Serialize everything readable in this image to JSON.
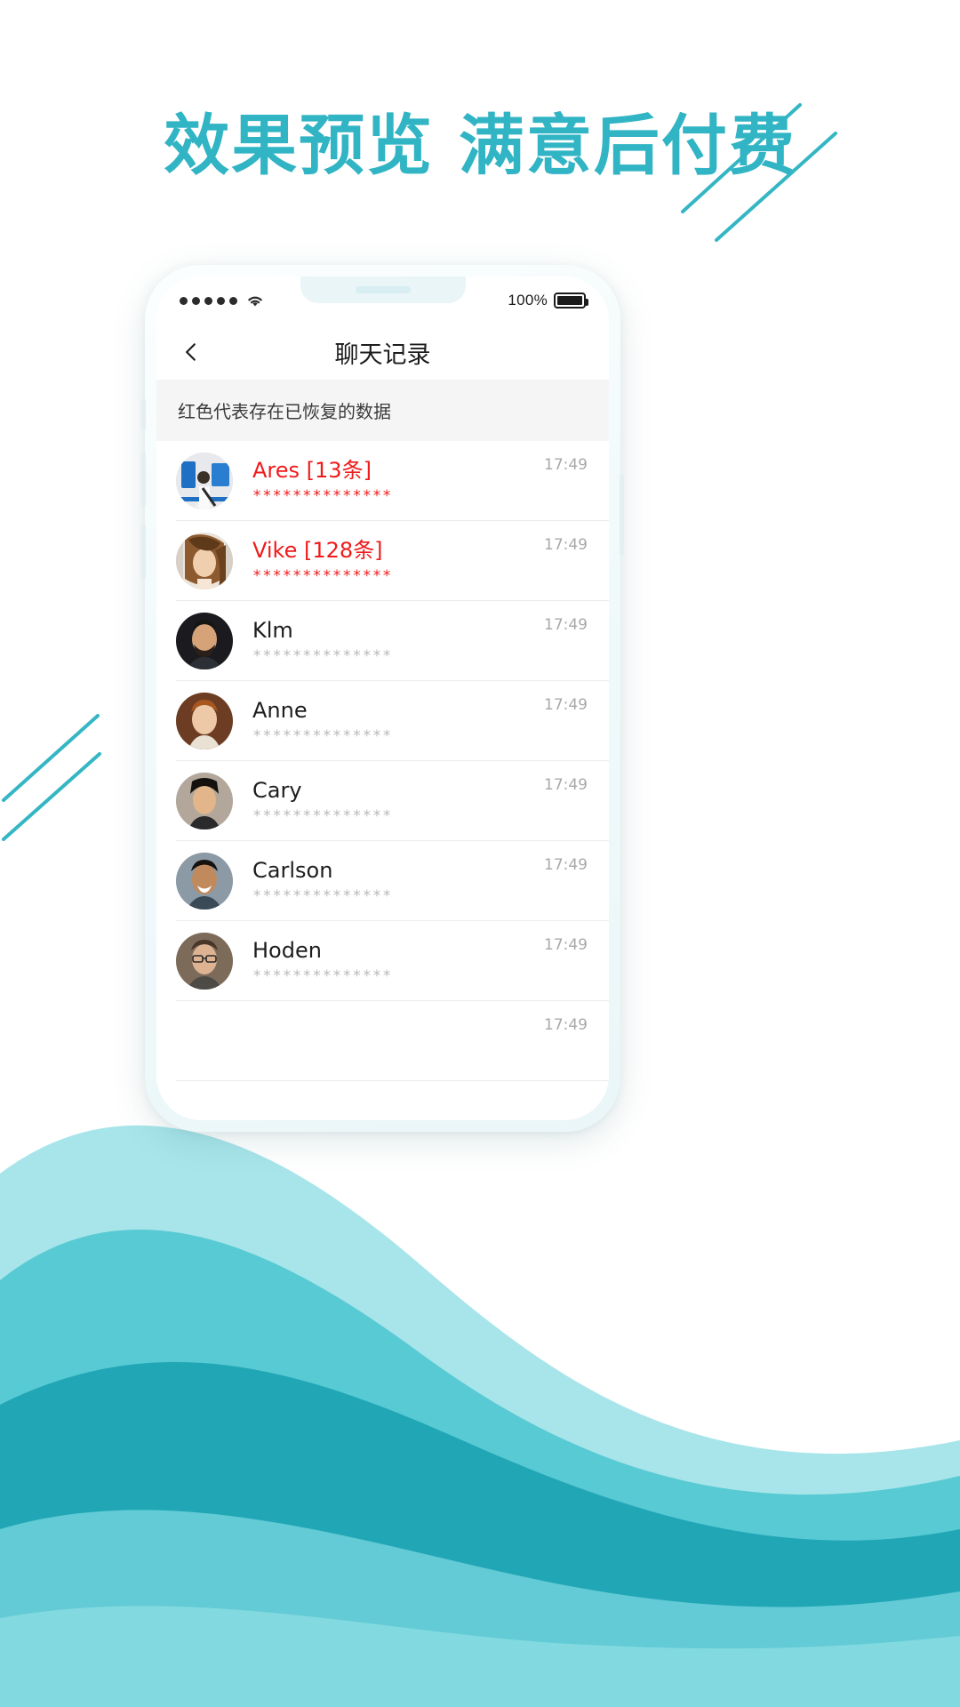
{
  "headline": "效果预览 满意后付费",
  "theme": {
    "accent": "#31b4c4",
    "wave_dark": "#2aa9b8",
    "wave_mid": "#45c3cf",
    "wave_light": "#8fe0e6",
    "flag_color": "#ef1b1b",
    "text_color": "#1d1d1d",
    "muted_color": "#a8a8a8"
  },
  "phone": {
    "status_bar": {
      "signal_icon": "signal-dots-icon",
      "signal_dots": 5,
      "wifi_icon": "wifi-icon",
      "battery_percent": "100%",
      "battery_icon": "battery-full-icon"
    },
    "nav": {
      "back_icon": "chevron-left-icon",
      "title": "聊天记录"
    },
    "banner": {
      "text": "红色代表存在已恢复的数据"
    },
    "list": {
      "masked_preview": "**************",
      "rows": [
        {
          "name": "Ares",
          "count_label": "[13条]",
          "preview": "**************",
          "time": "17:49",
          "flagged": true,
          "avatar": "photo-man-blue-door"
        },
        {
          "name": "Vike",
          "count_label": "[128条]",
          "preview": "**************",
          "time": "17:49",
          "flagged": true,
          "avatar": "photo-woman-long-hair"
        },
        {
          "name": "Klm",
          "count_label": "",
          "preview": "**************",
          "time": "17:49",
          "flagged": false,
          "avatar": "photo-man-beard"
        },
        {
          "name": "Anne",
          "count_label": "",
          "preview": "**************",
          "time": "17:49",
          "flagged": false,
          "avatar": "photo-woman-short-hair"
        },
        {
          "name": "Cary",
          "count_label": "",
          "preview": "**************",
          "time": "17:49",
          "flagged": false,
          "avatar": "photo-woman-dark-hair"
        },
        {
          "name": "Carlson",
          "count_label": "",
          "preview": "**************",
          "time": "17:49",
          "flagged": false,
          "avatar": "photo-man-smiling"
        },
        {
          "name": "Hoden",
          "count_label": "",
          "preview": "**************",
          "time": "17:49",
          "flagged": false,
          "avatar": "photo-man-glasses"
        },
        {
          "name": "",
          "count_label": "",
          "preview": "",
          "time": "17:49",
          "flagged": false,
          "avatar": ""
        }
      ]
    }
  }
}
